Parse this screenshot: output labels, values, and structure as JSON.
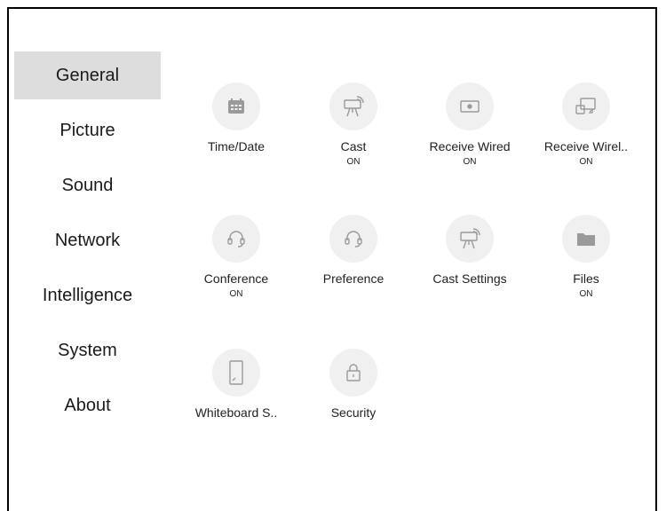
{
  "sidebar": {
    "items": [
      {
        "label": "General",
        "active": true
      },
      {
        "label": "Picture"
      },
      {
        "label": "Sound"
      },
      {
        "label": "Network"
      },
      {
        "label": "Intelligence"
      },
      {
        "label": "System"
      },
      {
        "label": "About"
      }
    ]
  },
  "tiles": [
    {
      "label": "Time/Date",
      "sub": "",
      "icon": "calendar-icon"
    },
    {
      "label": "Cast",
      "sub": "ON",
      "icon": "cast-icon"
    },
    {
      "label": "Receive Wired",
      "sub": "ON",
      "icon": "receive-wired-icon"
    },
    {
      "label": "Receive Wirel..",
      "sub": "ON",
      "icon": "receive-wireless-icon"
    },
    {
      "label": "Conference",
      "sub": "ON",
      "icon": "headset-icon"
    },
    {
      "label": "Preference",
      "sub": "",
      "icon": "headset-icon"
    },
    {
      "label": "Cast Settings",
      "sub": "",
      "icon": "cast-icon"
    },
    {
      "label": "Files",
      "sub": "ON",
      "icon": "folder-icon"
    },
    {
      "label": "Whiteboard S..",
      "sub": "",
      "icon": "whiteboard-icon"
    },
    {
      "label": "Security",
      "sub": "",
      "icon": "lock-icon"
    }
  ],
  "colors": {
    "icon_bg": "#f0f0f0",
    "icon_stroke": "#9a9a9a",
    "active_bg": "#dddddd"
  }
}
